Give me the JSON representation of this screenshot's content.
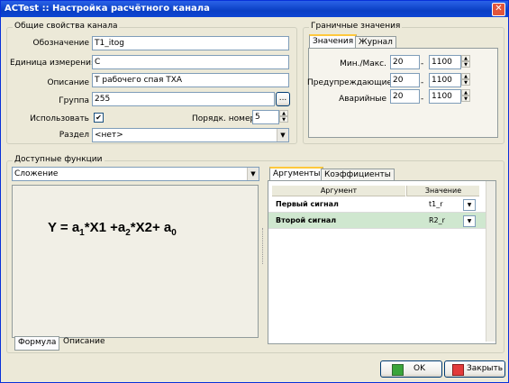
{
  "window": {
    "title": "ACTest :: Настройка расчётного канала",
    "close": "✕"
  },
  "general": {
    "title": "Общие свойства канала",
    "designation_label": "Обозначение",
    "designation_value": "T1_itog",
    "unit_label": "Единица измерения",
    "unit_value": "C",
    "description_label": "Описание",
    "description_value": "T рабочего спая ТХА",
    "group_label": "Группа",
    "group_value": "255",
    "browse": "...",
    "use_label": "Использовать",
    "use_checked": "✔",
    "order_label": "Порядк. номер",
    "order_value": "5",
    "section_label": "Раздел",
    "section_value": "<нет>"
  },
  "limits": {
    "title": "Граничные значения",
    "tabs": [
      "Значения",
      "Журнал"
    ],
    "rows": [
      {
        "label": "Мин./Макс.",
        "min": "20",
        "dash": "-",
        "max": "1100"
      },
      {
        "label": "Предупреждающие",
        "min": "20",
        "dash": "-",
        "max": "1100"
      },
      {
        "label": "Аварийные",
        "min": "20",
        "dash": "-",
        "max": "1100"
      }
    ]
  },
  "functions": {
    "title": "Доступные функции",
    "selected": "Сложение",
    "formula": {
      "Y": "Y = a",
      "s1": "1",
      "p1": "*X1 +a",
      "s2": "2",
      "p2": "*X2+ a",
      "s0": "0"
    },
    "tabs": [
      "Формула",
      "Описание"
    ]
  },
  "args": {
    "tabs": [
      "Аргументы",
      "Коэффициенты"
    ],
    "headers": {
      "arg": "Аргумент",
      "value": "Значение"
    },
    "rows": [
      {
        "name": "Первый сигнал",
        "value": "t1_r"
      },
      {
        "name": "Второй сигнал",
        "value": "R2_r"
      }
    ]
  },
  "buttons": {
    "ok": "OK",
    "close": "Закрыть"
  },
  "colors": {
    "accent_tab": "#ffc83c",
    "selected_row": "#cfe7cf",
    "ok_icon": "#3aa53a",
    "close_icon": "#e23b3b"
  }
}
